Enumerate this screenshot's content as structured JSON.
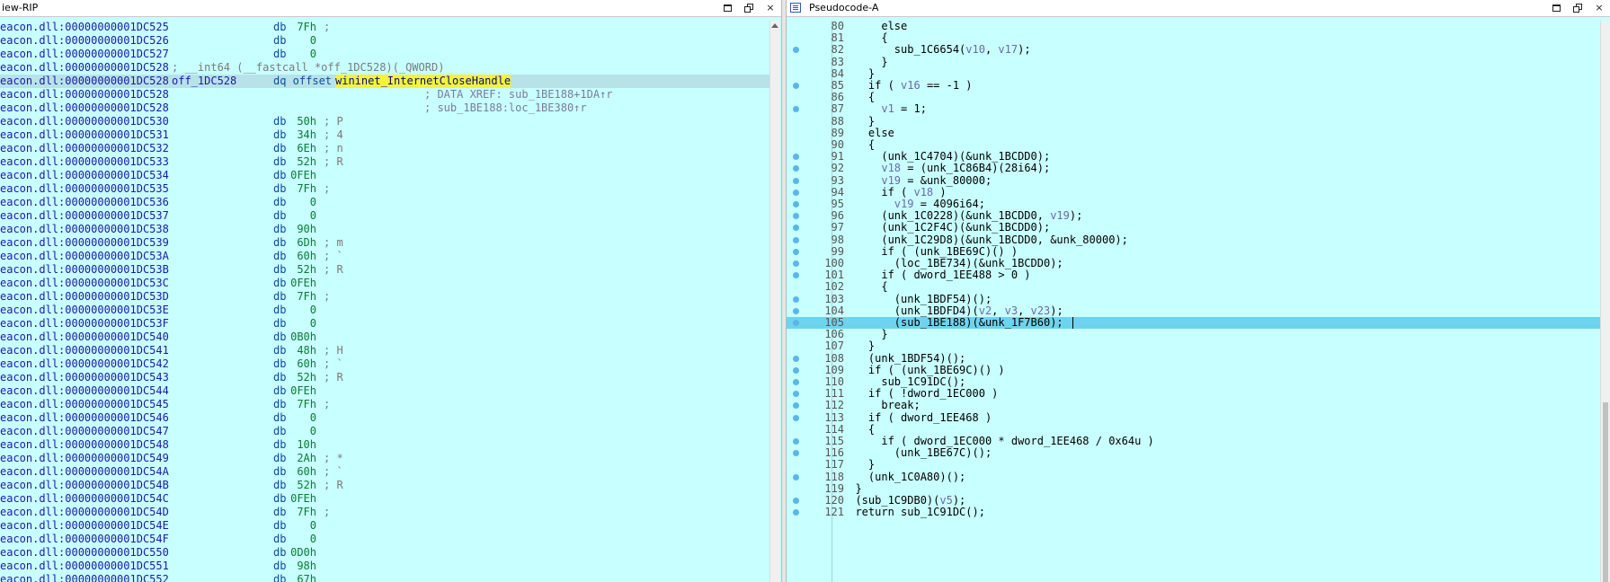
{
  "left_view": {
    "title": "iew-RIP",
    "listing": [
      {
        "addr": "eacon.dll:00000000001DC525",
        "op": "db",
        "val": "7Fh",
        "cmt": ";"
      },
      {
        "addr": "eacon.dll:00000000001DC526",
        "op": "db",
        "val": "0",
        "cmt": ""
      },
      {
        "addr": "eacon.dll:00000000001DC527",
        "op": "db",
        "val": "0",
        "cmt": ""
      },
      {
        "addr": "eacon.dll:00000000001DC528",
        "op": "",
        "val": "",
        "cmt": "",
        "longcmt": "; __int64 (__fastcall *off_1DC528)(_QWORD)"
      },
      {
        "addr": "eacon.dll:00000000001DC528",
        "lbl": "off_1DC528",
        "dq": "dq offset",
        "sym": "wininet_InternetCloseHandle",
        "highlight": true
      },
      {
        "addr": "eacon.dll:00000000001DC528",
        "xref": "; DATA XREF: sub_1BE188+1DA↑r"
      },
      {
        "addr": "eacon.dll:00000000001DC528",
        "xref": "; sub_1BE188:loc_1BE380↑r"
      },
      {
        "addr": "eacon.dll:00000000001DC530",
        "op": "db",
        "val": "50h",
        "cmt": "; P"
      },
      {
        "addr": "eacon.dll:00000000001DC531",
        "op": "db",
        "val": "34h",
        "cmt": "; 4"
      },
      {
        "addr": "eacon.dll:00000000001DC532",
        "op": "db",
        "val": "6Eh",
        "cmt": "; n"
      },
      {
        "addr": "eacon.dll:00000000001DC533",
        "op": "db",
        "val": "52h",
        "cmt": "; R"
      },
      {
        "addr": "eacon.dll:00000000001DC534",
        "op": "db",
        "val": "0FEh",
        "cmt": ""
      },
      {
        "addr": "eacon.dll:00000000001DC535",
        "op": "db",
        "val": "7Fh",
        "cmt": ";"
      },
      {
        "addr": "eacon.dll:00000000001DC536",
        "op": "db",
        "val": "0",
        "cmt": ""
      },
      {
        "addr": "eacon.dll:00000000001DC537",
        "op": "db",
        "val": "0",
        "cmt": ""
      },
      {
        "addr": "eacon.dll:00000000001DC538",
        "op": "db",
        "val": "90h",
        "cmt": ""
      },
      {
        "addr": "eacon.dll:00000000001DC539",
        "op": "db",
        "val": "6Dh",
        "cmt": "; m"
      },
      {
        "addr": "eacon.dll:00000000001DC53A",
        "op": "db",
        "val": "60h",
        "cmt": "; `"
      },
      {
        "addr": "eacon.dll:00000000001DC53B",
        "op": "db",
        "val": "52h",
        "cmt": "; R"
      },
      {
        "addr": "eacon.dll:00000000001DC53C",
        "op": "db",
        "val": "0FEh",
        "cmt": ""
      },
      {
        "addr": "eacon.dll:00000000001DC53D",
        "op": "db",
        "val": "7Fh",
        "cmt": ";"
      },
      {
        "addr": "eacon.dll:00000000001DC53E",
        "op": "db",
        "val": "0",
        "cmt": ""
      },
      {
        "addr": "eacon.dll:00000000001DC53F",
        "op": "db",
        "val": "0",
        "cmt": ""
      },
      {
        "addr": "eacon.dll:00000000001DC540",
        "op": "db",
        "val": "0B0h",
        "cmt": ""
      },
      {
        "addr": "eacon.dll:00000000001DC541",
        "op": "db",
        "val": "48h",
        "cmt": "; H"
      },
      {
        "addr": "eacon.dll:00000000001DC542",
        "op": "db",
        "val": "60h",
        "cmt": "; `"
      },
      {
        "addr": "eacon.dll:00000000001DC543",
        "op": "db",
        "val": "52h",
        "cmt": "; R"
      },
      {
        "addr": "eacon.dll:00000000001DC544",
        "op": "db",
        "val": "0FEh",
        "cmt": ""
      },
      {
        "addr": "eacon.dll:00000000001DC545",
        "op": "db",
        "val": "7Fh",
        "cmt": ";"
      },
      {
        "addr": "eacon.dll:00000000001DC546",
        "op": "db",
        "val": "0",
        "cmt": ""
      },
      {
        "addr": "eacon.dll:00000000001DC547",
        "op": "db",
        "val": "0",
        "cmt": ""
      },
      {
        "addr": "eacon.dll:00000000001DC548",
        "op": "db",
        "val": "10h",
        "cmt": ""
      },
      {
        "addr": "eacon.dll:00000000001DC549",
        "op": "db",
        "val": "2Ah",
        "cmt": "; *"
      },
      {
        "addr": "eacon.dll:00000000001DC54A",
        "op": "db",
        "val": "60h",
        "cmt": "; `"
      },
      {
        "addr": "eacon.dll:00000000001DC54B",
        "op": "db",
        "val": "52h",
        "cmt": "; R"
      },
      {
        "addr": "eacon.dll:00000000001DC54C",
        "op": "db",
        "val": "0FEh",
        "cmt": ""
      },
      {
        "addr": "eacon.dll:00000000001DC54D",
        "op": "db",
        "val": "7Fh",
        "cmt": ";"
      },
      {
        "addr": "eacon.dll:00000000001DC54E",
        "op": "db",
        "val": "0",
        "cmt": ""
      },
      {
        "addr": "eacon.dll:00000000001DC54F",
        "op": "db",
        "val": "0",
        "cmt": ""
      },
      {
        "addr": "eacon.dll:00000000001DC550",
        "op": "db",
        "val": "0D0h",
        "cmt": ""
      },
      {
        "addr": "eacon.dll:00000000001DC551",
        "op": "db",
        "val": "98h",
        "cmt": ""
      },
      {
        "addr": "eacon.dll:00000000001DC552",
        "op": "db",
        "val": "67h",
        "cmt": ""
      }
    ]
  },
  "right_view": {
    "title": "Pseudocode-A",
    "lines": [
      {
        "n": "80",
        "dot": false,
        "code": "      else"
      },
      {
        "n": "81",
        "dot": false,
        "code": "      {"
      },
      {
        "n": "82",
        "dot": true,
        "code": "        sub_1C6654(v10, v17);"
      },
      {
        "n": "83",
        "dot": false,
        "code": "      }"
      },
      {
        "n": "84",
        "dot": false,
        "code": "    }"
      },
      {
        "n": "85",
        "dot": true,
        "code": "    if ( v16 == -1 )"
      },
      {
        "n": "86",
        "dot": false,
        "code": "    {"
      },
      {
        "n": "87",
        "dot": true,
        "code": "      v1 = 1;"
      },
      {
        "n": "88",
        "dot": false,
        "code": "    }"
      },
      {
        "n": "89",
        "dot": false,
        "code": "    else"
      },
      {
        "n": "90",
        "dot": false,
        "code": "    {"
      },
      {
        "n": "91",
        "dot": true,
        "code": "      (unk_1C4704)(&unk_1BCDD0);"
      },
      {
        "n": "92",
        "dot": true,
        "code": "      v18 = (unk_1C86B4)(28i64);"
      },
      {
        "n": "93",
        "dot": true,
        "code": "      v19 = &unk_80000;"
      },
      {
        "n": "94",
        "dot": true,
        "code": "      if ( v18 )"
      },
      {
        "n": "95",
        "dot": true,
        "code": "        v19 = 4096i64;"
      },
      {
        "n": "96",
        "dot": true,
        "code": "      (unk_1C0228)(&unk_1BCDD0, v19);"
      },
      {
        "n": "97",
        "dot": true,
        "code": "      (unk_1C2F4C)(&unk_1BCDD0);"
      },
      {
        "n": "98",
        "dot": true,
        "code": "      (unk_1C29D8)(&unk_1BCDD0, &unk_80000);"
      },
      {
        "n": "99",
        "dot": true,
        "code": "      if ( (unk_1BE69C)() )"
      },
      {
        "n": "100",
        "dot": true,
        "code": "        (loc_1BE734)(&unk_1BCDD0);"
      },
      {
        "n": "101",
        "dot": true,
        "code": "      if ( dword_1EE488 > 0 )"
      },
      {
        "n": "102",
        "dot": false,
        "code": "      {"
      },
      {
        "n": "103",
        "dot": true,
        "code": "        (unk_1BDF54)();"
      },
      {
        "n": "104",
        "dot": true,
        "code": "        (unk_1BDFD4)(v2, v3, v23);"
      },
      {
        "n": "105",
        "dot": true,
        "code": "        (sub_1BE188)(&unk_1F7B60);",
        "current": true
      },
      {
        "n": "106",
        "dot": false,
        "code": "      }"
      },
      {
        "n": "107",
        "dot": false,
        "code": "    }"
      },
      {
        "n": "108",
        "dot": true,
        "code": "    (unk_1BDF54)();"
      },
      {
        "n": "109",
        "dot": true,
        "code": "    if ( (unk_1BE69C)() )"
      },
      {
        "n": "110",
        "dot": true,
        "code": "      sub_1C91DC();"
      },
      {
        "n": "111",
        "dot": true,
        "code": "    if ( !dword_1EC000 )"
      },
      {
        "n": "112",
        "dot": true,
        "code": "      break;"
      },
      {
        "n": "113",
        "dot": true,
        "code": "    if ( dword_1EE468 )"
      },
      {
        "n": "114",
        "dot": false,
        "code": "    {"
      },
      {
        "n": "115",
        "dot": true,
        "code": "      if ( dword_1EC000 * dword_1EE468 / 0x64u )"
      },
      {
        "n": "116",
        "dot": true,
        "code": "        (unk_1BE67C)();"
      },
      {
        "n": "117",
        "dot": false,
        "code": "    }"
      },
      {
        "n": "118",
        "dot": true,
        "code": "    (unk_1C0A80)();"
      },
      {
        "n": "119",
        "dot": false,
        "code": "  }"
      },
      {
        "n": "120",
        "dot": true,
        "code": "  (sub_1C9DB0)(v5);"
      },
      {
        "n": "121",
        "dot": true,
        "code": "  return sub_1C91DC();"
      }
    ]
  },
  "window_buttons": {
    "restore_label": "",
    "close_label": "×"
  }
}
